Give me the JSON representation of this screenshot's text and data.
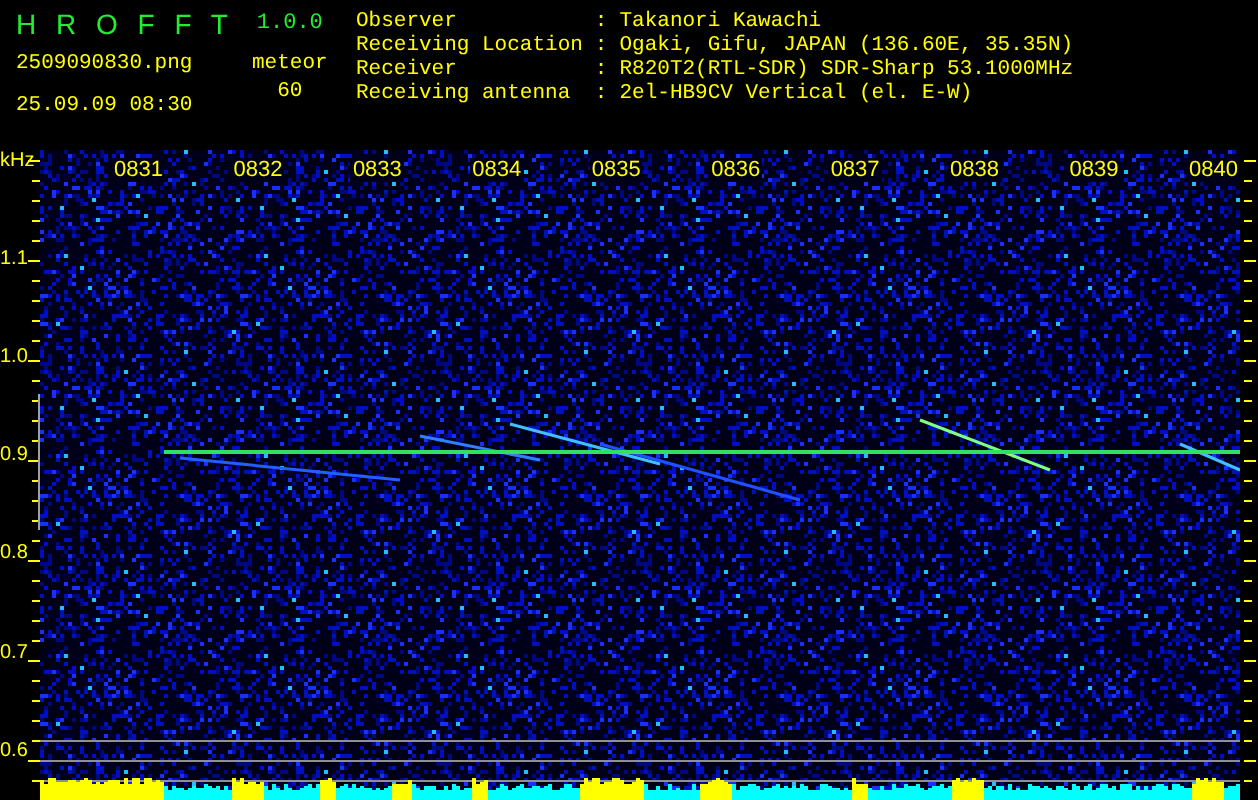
{
  "header": {
    "app_title": "H R O F F T",
    "version": "1.0.0",
    "file_name": "2509090830.png",
    "timestamp": "25.09.09 08:30",
    "meteor_label": "meteor",
    "meteor_count": "60"
  },
  "station_info": [
    {
      "label": "Observer",
      "separator": ":",
      "value": "Takanori Kawachi"
    },
    {
      "label": "Receiving Location",
      "separator": ":",
      "value": "Ogaki, Gifu, JAPAN (136.60E, 35.35N)"
    },
    {
      "label": "Receiver",
      "separator": ":",
      "value": "R820T2(RTL-SDR) SDR-Sharp 53.1000MHz"
    },
    {
      "label": "Receiving antenna",
      "separator": ":",
      "value": "2el-HB9CV Vertical (el. E-W)"
    }
  ],
  "spectrogram": {
    "frequency_unit": "kHz",
    "frequency_labels": [
      "1.1",
      "1.0",
      "0.9",
      "0.8",
      "0.7",
      "0.6"
    ],
    "time_labels": [
      "0831",
      "0832",
      "0833",
      "0834",
      "0835",
      "0836",
      "0837",
      "0838",
      "0839",
      "0840"
    ]
  }
}
